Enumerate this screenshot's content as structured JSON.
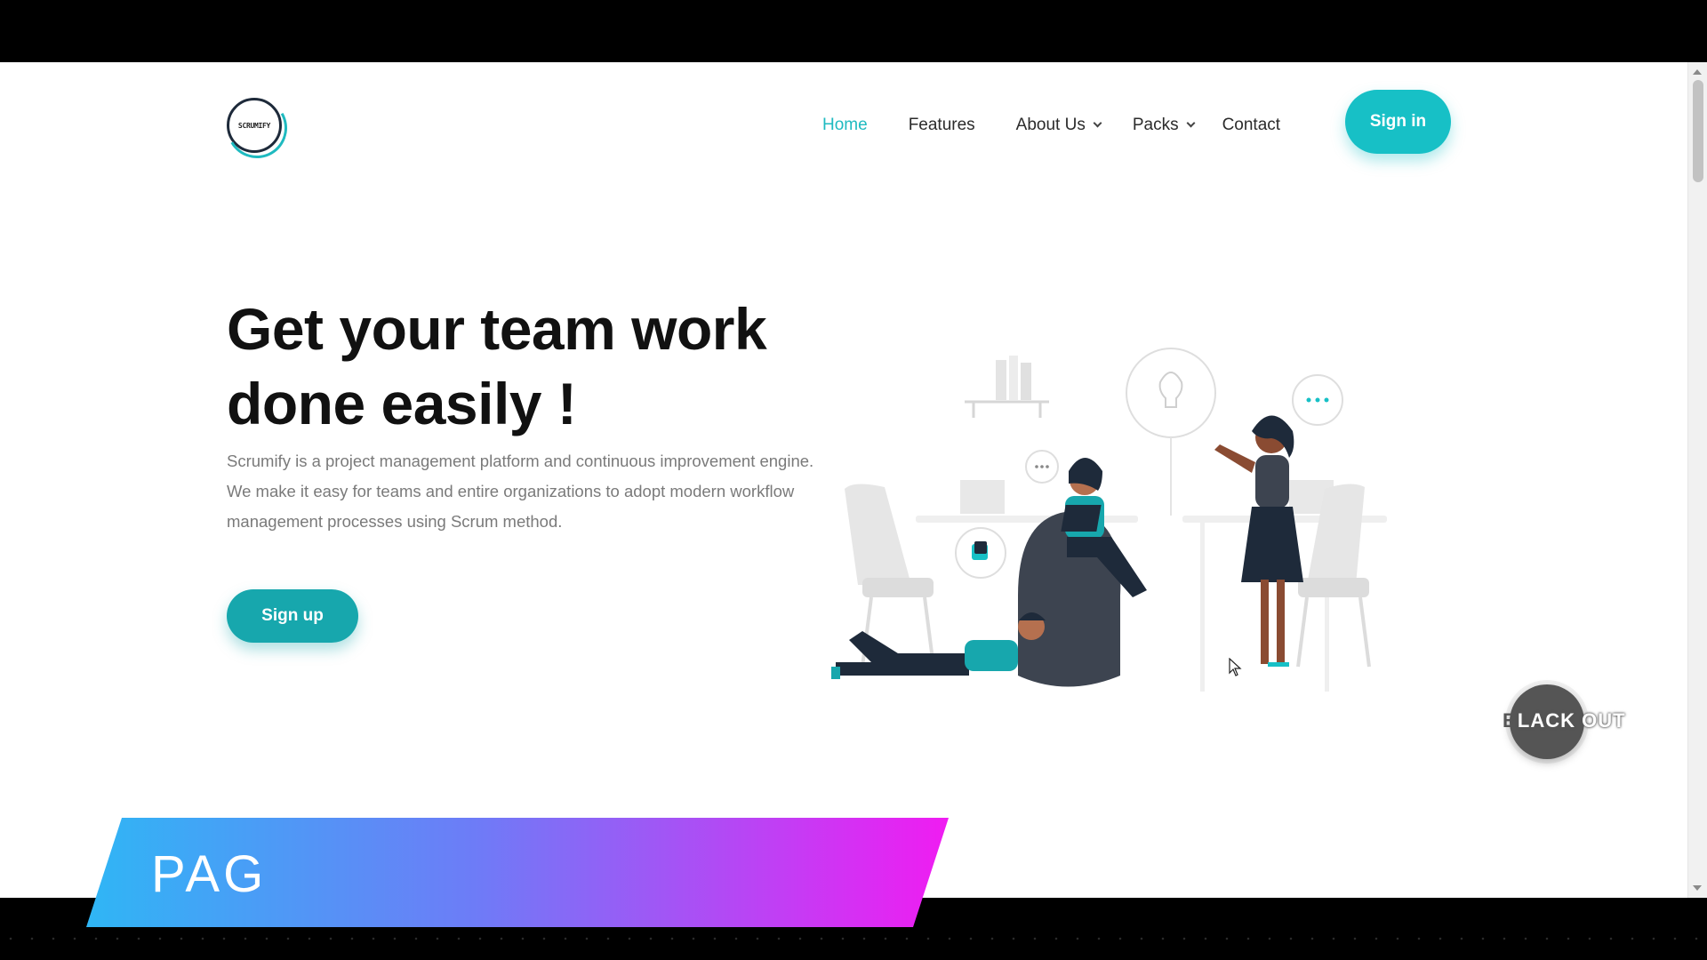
{
  "app": {
    "logo_text": "SCRUMIFY"
  },
  "nav": {
    "items": [
      {
        "label": "Home",
        "active": true,
        "dropdown": false
      },
      {
        "label": "Features",
        "active": false,
        "dropdown": false
      },
      {
        "label": "About Us",
        "active": false,
        "dropdown": true
      },
      {
        "label": "Packs",
        "active": false,
        "dropdown": true
      },
      {
        "label": "Contact",
        "active": false,
        "dropdown": false
      }
    ],
    "signin_label": "Sign in"
  },
  "hero": {
    "title_line1": "Get your team work",
    "title_line2": "done easily !",
    "description": "Scrumify is a project management platform and continuous improvement engine. We make it easy for teams and entire organizations to adopt modern workflow management processes using Scrum method.",
    "signup_label": "Sign up"
  },
  "overlays": {
    "watermark_text_a": "B",
    "watermark_text_b": "LACK OUT",
    "banner_text": "PAG"
  },
  "colors": {
    "accent": "#17c0c6",
    "banner_start": "#2fb6f5",
    "banner_end": "#f01cf2"
  },
  "icons": [
    "chevron-down-icon",
    "cursor-icon",
    "lightbulb-icon",
    "chat-bubble-icon"
  ]
}
